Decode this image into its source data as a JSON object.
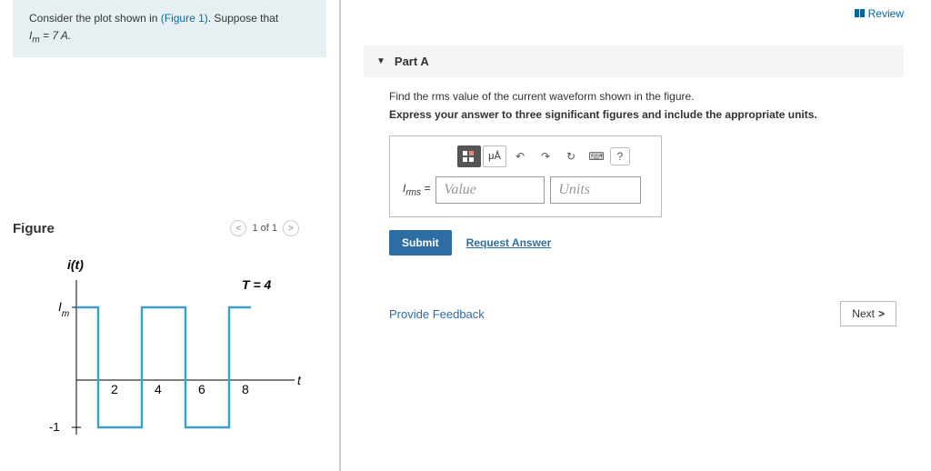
{
  "header": {
    "review_label": "Review"
  },
  "problem": {
    "intro_prefix": "Consider the plot shown in ",
    "figure_link": "(Figure 1)",
    "intro_suffix": ". Suppose that",
    "equation": "I_m = 7 A."
  },
  "figure": {
    "title": "Figure",
    "pager_text": "1 of 1",
    "pager_prev": "<",
    "pager_next": ">"
  },
  "chart_data": {
    "type": "line",
    "title": "",
    "xlabel": "t",
    "ylabel": "i(t)",
    "period_label": "T = 4",
    "ylim_lower_tick": "-1",
    "amp_label": "I_m",
    "x_ticks": [
      "2",
      "4",
      "6",
      "8"
    ],
    "series": [
      {
        "name": "current",
        "points": [
          {
            "x": 0,
            "y": 1
          },
          {
            "x": 1,
            "y": 1
          },
          {
            "x": 1,
            "y": -1
          },
          {
            "x": 3,
            "y": -1
          },
          {
            "x": 3,
            "y": 1
          },
          {
            "x": 5,
            "y": 1
          },
          {
            "x": 5,
            "y": -1
          },
          {
            "x": 7,
            "y": -1
          },
          {
            "x": 7,
            "y": 1
          },
          {
            "x": 8,
            "y": 1
          }
        ]
      }
    ]
  },
  "part": {
    "label": "Part A",
    "question": "Find the rms value of the current waveform shown in the figure.",
    "direction": "Express your answer to three significant figures and include the appropriate units.",
    "toolbar": {
      "units_btn": "μÅ",
      "undo": "↶",
      "redo": "↷",
      "reset": "↻",
      "kbd": "⌨",
      "help": "?"
    },
    "answer_label": "I_rms =",
    "value_placeholder": "Value",
    "units_placeholder": "Units",
    "submit_label": "Submit",
    "request_label": "Request Answer"
  },
  "footer": {
    "feedback_label": "Provide Feedback",
    "next_label": "Next",
    "next_caret": ">"
  }
}
